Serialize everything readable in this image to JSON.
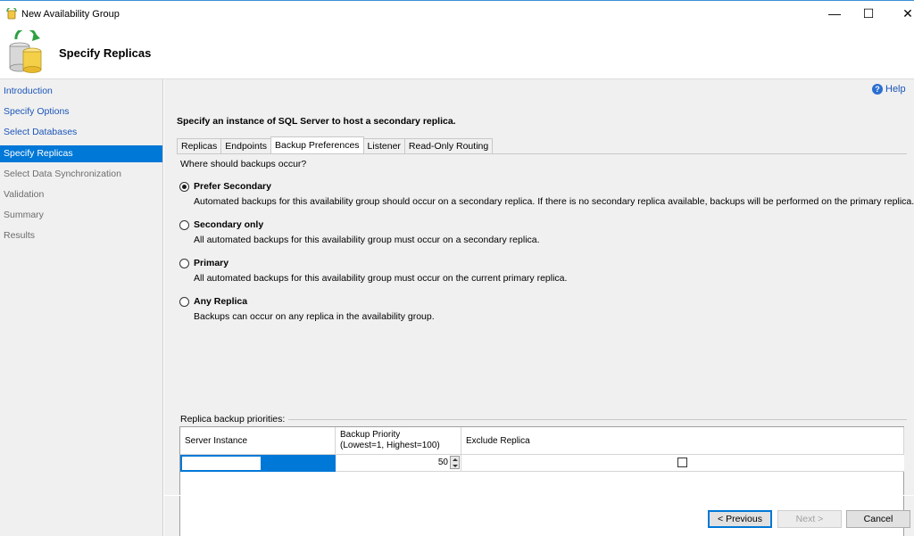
{
  "window": {
    "title": "New Availability Group",
    "minimize": "—",
    "maximize": "☐",
    "close": "✕"
  },
  "header": {
    "title": "Specify Replicas"
  },
  "sidebar": {
    "items": [
      {
        "label": "Introduction",
        "state": "link"
      },
      {
        "label": "Specify Options",
        "state": "link"
      },
      {
        "label": "Select Databases",
        "state": "link"
      },
      {
        "label": "Specify Replicas",
        "state": "active"
      },
      {
        "label": "Select Data Synchronization",
        "state": "dim"
      },
      {
        "label": "Validation",
        "state": "dim"
      },
      {
        "label": "Summary",
        "state": "dim"
      },
      {
        "label": "Results",
        "state": "dim"
      }
    ]
  },
  "help": {
    "label": "Help",
    "icon": "help-icon"
  },
  "instruction": "Specify an instance of SQL Server to host a secondary replica.",
  "tabs": [
    {
      "label": "Replicas"
    },
    {
      "label": "Endpoints"
    },
    {
      "label": "Backup Preferences",
      "selected": true
    },
    {
      "label": "Listener"
    },
    {
      "label": "Read-Only Routing"
    }
  ],
  "backup": {
    "question": "Where should backups occur?",
    "options": [
      {
        "label": "Prefer Secondary",
        "desc": "Automated backups for this availability group should occur on a secondary replica. If there is no secondary replica available, backups will be performed on the primary replica.",
        "checked": true
      },
      {
        "label": "Secondary only",
        "desc": "All automated backups for this availability group must occur on a secondary replica.",
        "checked": false
      },
      {
        "label": "Primary",
        "desc": "All automated backups for this availability group must occur on the current primary replica.",
        "checked": false
      },
      {
        "label": "Any Replica",
        "desc": "Backups can occur on any replica in the availability group.",
        "checked": false
      }
    ],
    "group_label": "Replica backup priorities:",
    "grid": {
      "columns": [
        "Server Instance",
        "Backup Priority",
        "(Lowest=1, Highest=100)",
        "Exclude Replica"
      ],
      "rows": [
        {
          "server": "",
          "priority": "50",
          "exclude": false
        }
      ]
    }
  },
  "buttons": {
    "previous": "< Previous",
    "next": "Next >",
    "cancel": "Cancel"
  },
  "colors": {
    "accent": "#0078d7",
    "link": "#1a55b8",
    "panel": "#f0f0f0"
  }
}
